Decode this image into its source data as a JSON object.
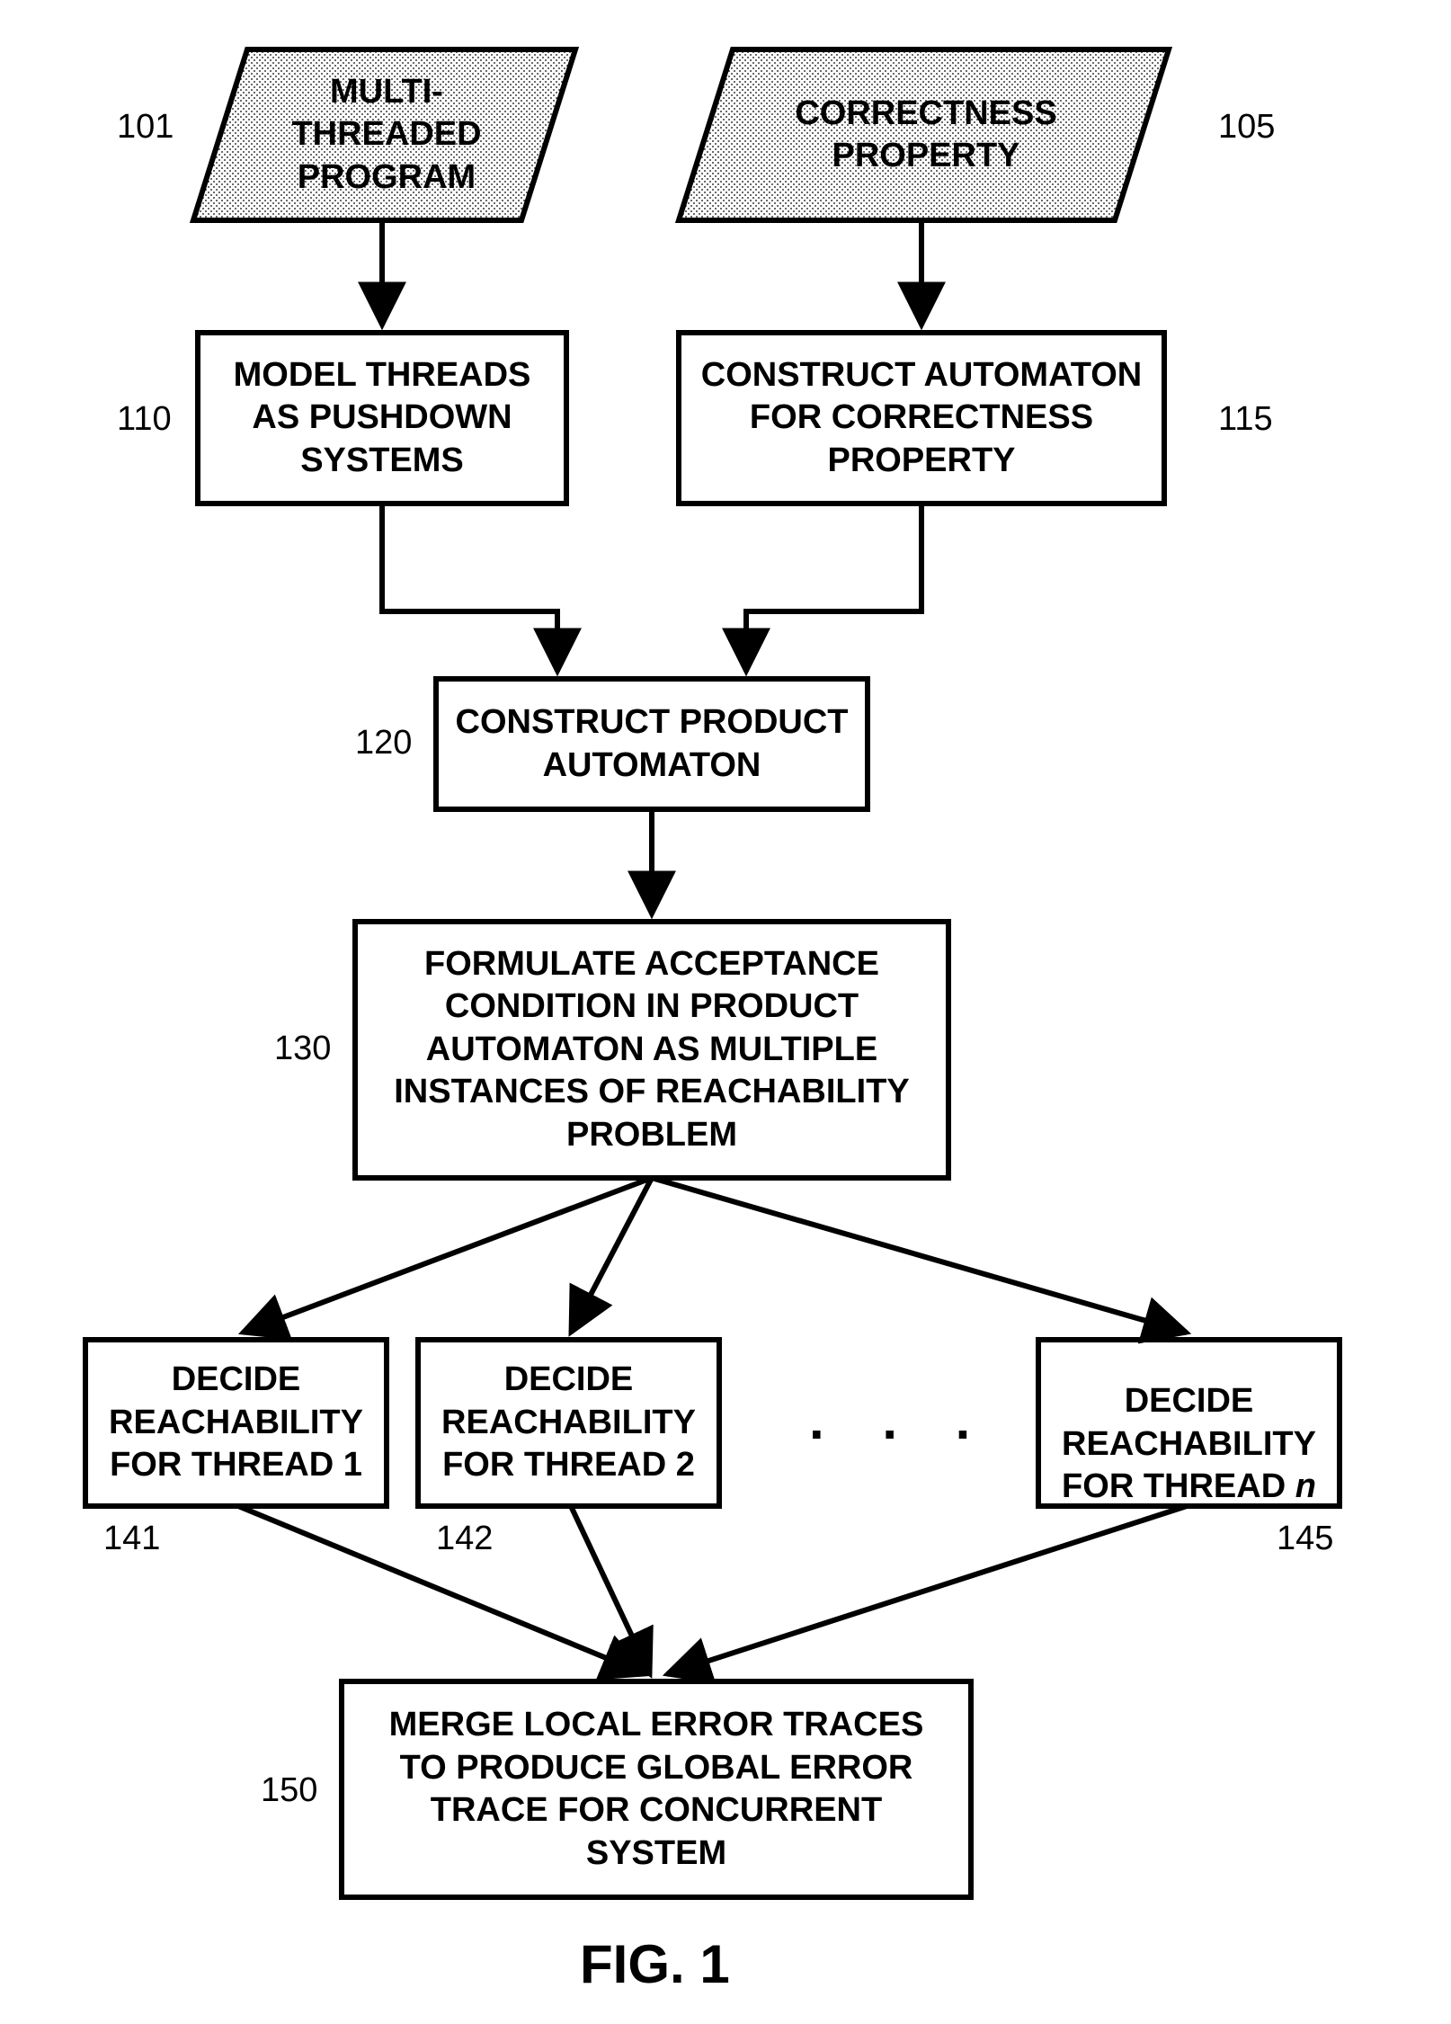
{
  "chart_data": {
    "type": "flowchart",
    "title": "FIG. 1",
    "nodes": [
      {
        "id": "101",
        "shape": "parallelogram",
        "text": "MULTI-\nTHREADED\nPROGRAM",
        "shaded": true
      },
      {
        "id": "105",
        "shape": "parallelogram",
        "text": "CORRECTNESS\nPROPERTY",
        "shaded": true
      },
      {
        "id": "110",
        "shape": "rect",
        "text": "MODEL THREADS\nAS PUSHDOWN\nSYSTEMS"
      },
      {
        "id": "115",
        "shape": "rect",
        "text": "CONSTRUCT AUTOMATON\nFOR CORRECTNESS\nPROPERTY"
      },
      {
        "id": "120",
        "shape": "rect",
        "text": "CONSTRUCT PRODUCT\nAUTOMATON"
      },
      {
        "id": "130",
        "shape": "rect",
        "text": "FORMULATE ACCEPTANCE\nCONDITION IN PRODUCT\nAUTOMATON AS MULTIPLE\nINSTANCES OF REACHABILITY\nPROBLEM"
      },
      {
        "id": "141",
        "shape": "rect",
        "text": "DECIDE\nREACHABILITY\nFOR THREAD 1"
      },
      {
        "id": "142",
        "shape": "rect",
        "text": "DECIDE\nREACHABILITY\nFOR THREAD 2"
      },
      {
        "id": "145",
        "shape": "rect",
        "text": "DECIDE\nREACHABILITY\nFOR THREAD n",
        "italic_index": "n"
      },
      {
        "id": "150",
        "shape": "rect",
        "text": "MERGE LOCAL ERROR TRACES\nTO PRODUCE GLOBAL ERROR\nTRACE FOR CONCURRENT\nSYSTEM"
      }
    ],
    "edges": [
      [
        "101",
        "110"
      ],
      [
        "105",
        "115"
      ],
      [
        "110",
        "120"
      ],
      [
        "115",
        "120"
      ],
      [
        "120",
        "130"
      ],
      [
        "130",
        "141"
      ],
      [
        "130",
        "142"
      ],
      [
        "130",
        "145"
      ],
      [
        "141",
        "150"
      ],
      [
        "142",
        "150"
      ],
      [
        "145",
        "150"
      ]
    ],
    "labels": {
      "n101": "101",
      "n105": "105",
      "n110": "110",
      "n115": "115",
      "n120": "120",
      "n130": "130",
      "n141": "141",
      "n142": "142",
      "n145": "145",
      "n150": "150"
    },
    "ellipsis": ". . ."
  },
  "boxes": {
    "b101": "MULTI-\nTHREADED\nPROGRAM",
    "b105": "CORRECTNESS\nPROPERTY",
    "b110": "MODEL THREADS\nAS PUSHDOWN\nSYSTEMS",
    "b115": "CONSTRUCT AUTOMATON\nFOR CORRECTNESS\nPROPERTY",
    "b120": "CONSTRUCT PRODUCT\nAUTOMATON",
    "b130": "FORMULATE ACCEPTANCE\nCONDITION IN PRODUCT\nAUTOMATON AS MULTIPLE\nINSTANCES OF REACHABILITY\nPROBLEM",
    "b141": "DECIDE\nREACHABILITY\nFOR THREAD 1",
    "b142": "DECIDE\nREACHABILITY\nFOR THREAD 2",
    "b145_prefix": "DECIDE\nREACHABILITY\nFOR THREAD ",
    "b145_n": "n",
    "b150": "MERGE LOCAL ERROR TRACES\nTO PRODUCE GLOBAL ERROR\nTRACE FOR CONCURRENT\nSYSTEM"
  },
  "nums": {
    "n101": "101",
    "n105": "105",
    "n110": "110",
    "n115": "115",
    "n120": "120",
    "n130": "130",
    "n141": "141",
    "n142": "142",
    "n145": "145",
    "n150": "150"
  },
  "ellipsis": ".  .  .",
  "caption": "FIG. 1"
}
